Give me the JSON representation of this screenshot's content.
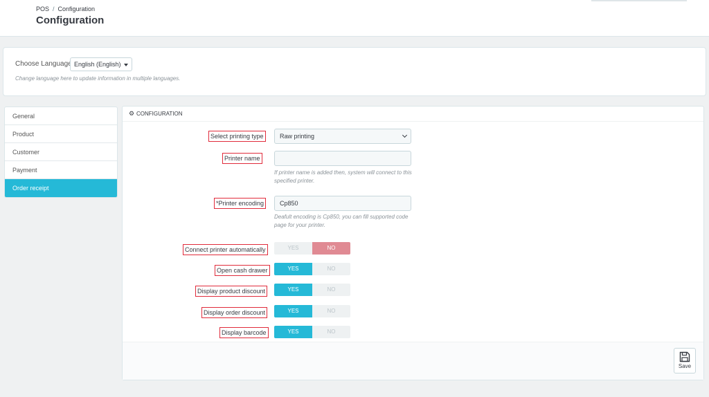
{
  "header": {
    "breadcrumb": [
      "POS",
      "Configuration"
    ],
    "breadcrumb_sep": "/",
    "title": "Configuration"
  },
  "language": {
    "label": "Choose Language",
    "selected": "English (English)",
    "help": "Change language here to update information in multiple languages."
  },
  "sidebar": {
    "items": [
      {
        "label": "General",
        "active": false
      },
      {
        "label": "Product",
        "active": false
      },
      {
        "label": "Customer",
        "active": false
      },
      {
        "label": "Payment",
        "active": false
      },
      {
        "label": "Order receipt",
        "active": true
      }
    ]
  },
  "panel": {
    "heading": "CONFIGURATION",
    "heading_icon": "cogs-icon",
    "printing_type": {
      "label": "Select printing type",
      "value": "Raw printing"
    },
    "printer_name": {
      "label": "Printer name",
      "value": "",
      "help": "If printer name is added then, system will connect to this specified printer."
    },
    "printer_encoding": {
      "label": "*Printer encoding",
      "value": "Cp850",
      "help": "Deafult encoding is Cp850, you can fill supported code page for your printer."
    },
    "toggles": [
      {
        "label": "Connect printer automatically",
        "yes": "YES",
        "no": "NO",
        "value": "no"
      },
      {
        "label": "Open cash drawer",
        "yes": "YES",
        "no": "NO",
        "value": "yes"
      },
      {
        "label": "Display product discount",
        "yes": "YES",
        "no": "NO",
        "value": "yes"
      },
      {
        "label": "Display order discount",
        "yes": "YES",
        "no": "NO",
        "value": "yes"
      },
      {
        "label": "Display barcode",
        "yes": "YES",
        "no": "NO",
        "value": "yes"
      }
    ],
    "save_label": "Save"
  },
  "colors": {
    "accent": "#25b9d7",
    "no_active": "#e08a93",
    "highlight_border": "#e02a3a"
  }
}
